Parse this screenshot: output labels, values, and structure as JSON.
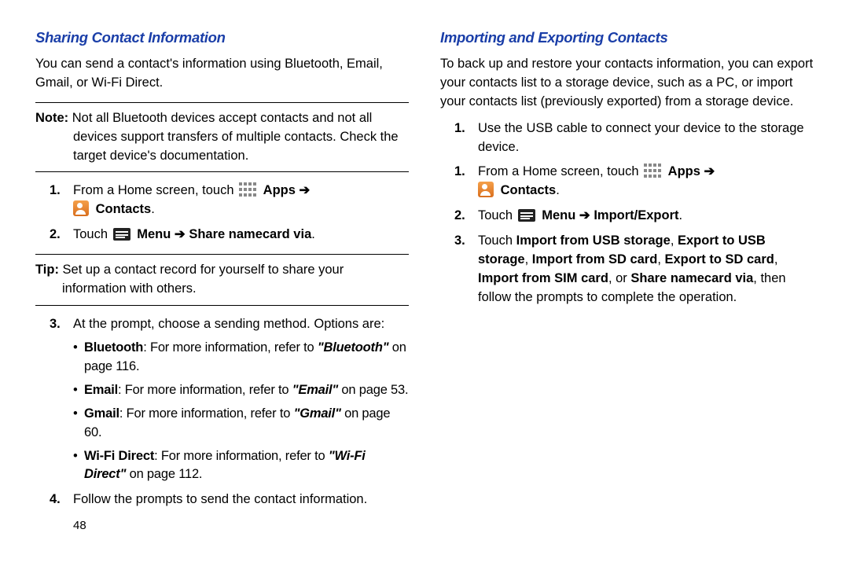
{
  "pageNumber": "48",
  "left": {
    "heading": "Sharing Contact Information",
    "intro": "You can send a contact's information using Bluetooth, Email, Gmail, or Wi-Fi Direct.",
    "noteLabel": "Note:",
    "noteBody": "Not all Bluetooth devices accept contacts and not all devices support transfers of multiple contacts. Check the target device's documentation.",
    "step1_lead": "From a Home screen, touch ",
    "appsLabel": "Apps",
    "arrow": "➔",
    "contactsLabel": "Contacts",
    "step2_lead": "Touch ",
    "menuLabel": "Menu",
    "shareLabel": "Share namecard via",
    "tipLabel": "Tip:",
    "tipBody": "Set up a contact record for yourself to share your information with others.",
    "step3_lead": "At the prompt, choose a sending method. Options are:",
    "opt_bt_label": "Bluetooth",
    "opt_refer": ": For more information, refer to ",
    "opt_bt_ref": "\"Bluetooth\"",
    "opt_bt_page": " on page 116.",
    "opt_em_label": "Email",
    "opt_em_ref": "\"Email\"",
    "opt_em_page": " on page 53.",
    "opt_gm_label": "Gmail",
    "opt_gm_ref": "\"Gmail\"",
    "opt_gm_page": " on page 60.",
    "opt_wf_label": "Wi-Fi Direct",
    "opt_wf_ref": "\"Wi-Fi Direct\"",
    "opt_wf_page": " on page 112.",
    "step4": "Follow the prompts to send the contact information."
  },
  "right": {
    "heading": "Importing and Exporting Contacts",
    "intro": "To back up and restore your contacts information, you can export your contacts list to a storage device, such as a PC, or import your contacts list (previously exported) from a storage device.",
    "step1": "Use the USB cable to connect your device to the storage device.",
    "step2_lead": "From a Home screen, touch ",
    "step3_lead": "Touch ",
    "importExportLabel": "Import/Export",
    "step4_lead": "Touch ",
    "opt_a": "Import from USB storage",
    "opt_b": "Export to USB storage",
    "opt_c": "Import from SD card",
    "opt_d": "Export to SD card",
    "opt_e": "Import from SIM card",
    "opt_f": "Share namecard via",
    "c1": ", ",
    "c_or": ", or ",
    "tail": ", then follow the prompts to complete the operation."
  }
}
